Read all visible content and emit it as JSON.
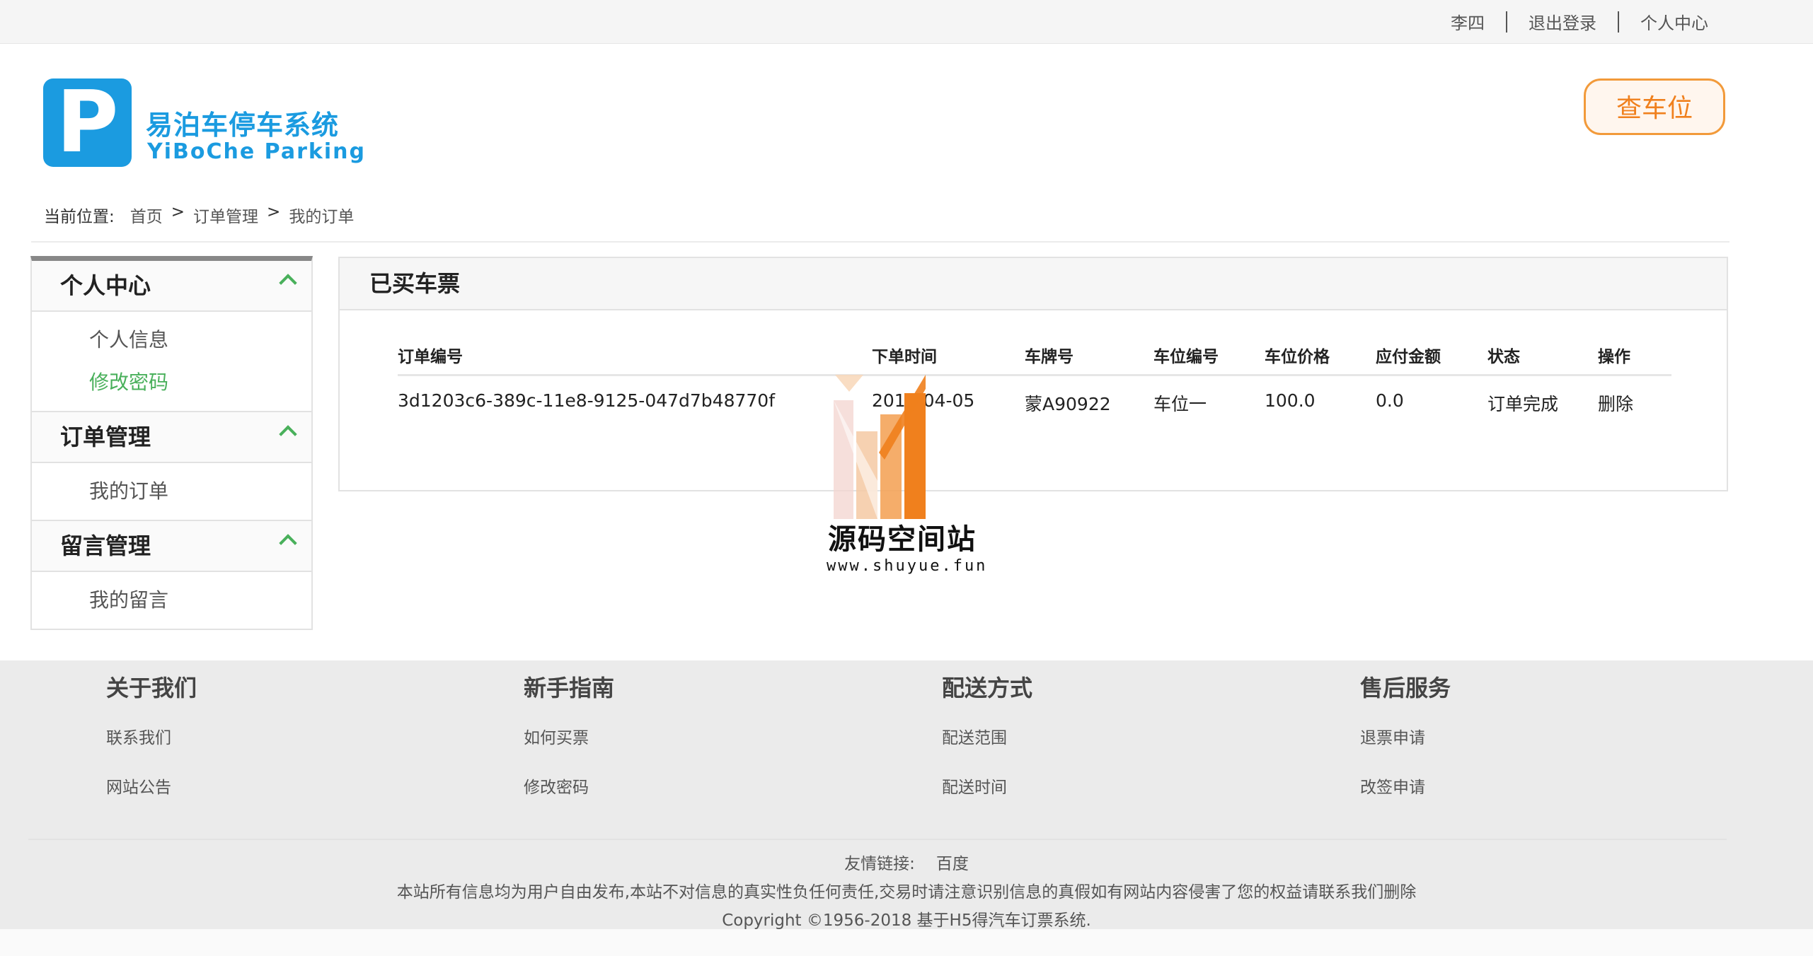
{
  "topbar": {
    "username": "李四",
    "logout": "退出登录",
    "personal_center": "个人中心"
  },
  "header": {
    "logo_letter": "P",
    "logo_cn": "易泊车停车系统",
    "logo_en": "YiBoChe  Parking",
    "check_button": "查车位",
    "brand_color": "#1b9be0",
    "accent_color": "#f0801d"
  },
  "breadcrumb": {
    "label": "当前位置:",
    "items": [
      "首页",
      "订单管理",
      "我的订单"
    ],
    "separator": ">"
  },
  "sidebar": {
    "sections": [
      {
        "title": "个人中心",
        "items": [
          {
            "label": "个人信息"
          },
          {
            "label": "修改密码",
            "active": true
          }
        ]
      },
      {
        "title": "订单管理",
        "items": [
          {
            "label": "我的订单"
          }
        ]
      },
      {
        "title": "留言管理",
        "items": [
          {
            "label": "我的留言"
          }
        ]
      }
    ]
  },
  "main": {
    "title": "已买车票",
    "columns": [
      "订单编号",
      "下单时间",
      "车牌号",
      "车位编号",
      "车位价格",
      "应付金额",
      "状态",
      "操作"
    ],
    "rows": [
      [
        "3d1203c6-389c-11e8-9125-047d7b48770f",
        "2018-04-05",
        "蒙A90922",
        "车位一",
        "100.0",
        "0.0",
        "订单完成",
        "删除"
      ]
    ]
  },
  "watermark": {
    "title": "源码空间站",
    "url": "www.shuyue.fun"
  },
  "footer": {
    "columns": [
      {
        "title": "关于我们",
        "links": [
          "联系我们",
          "网站公告"
        ]
      },
      {
        "title": "新手指南",
        "links": [
          "如何买票",
          "修改密码"
        ]
      },
      {
        "title": "配送方式",
        "links": [
          "配送范围",
          "配送时间"
        ]
      },
      {
        "title": "售后服务",
        "links": [
          "退票申请",
          "改签申请"
        ]
      }
    ],
    "friend_label": "友情链接:",
    "friend_link": "百度",
    "disclaimer": "本站所有信息均为用户自由发布,本站不对信息的真实性负任何责任,交易时请注意识别信息的真假如有网站内容侵害了您的权益请联系我们删除",
    "copyright": "Copyright ©1956-2018 基于H5得汽车订票系统."
  }
}
